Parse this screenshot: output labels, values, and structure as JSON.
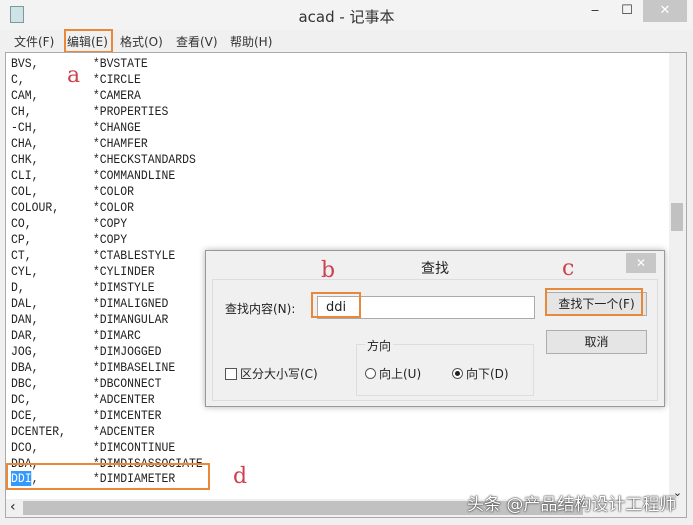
{
  "window": {
    "title": "acad - 记事本",
    "minimize": "‒",
    "maximize": "☐",
    "close": "✕"
  },
  "menu": [
    "文件(F)",
    "编辑(E)",
    "格式(O)",
    "查看(V)",
    "帮助(H)"
  ],
  "lines": [
    [
      "BVS,",
      "*BVSTATE"
    ],
    [
      "C,",
      "*CIRCLE"
    ],
    [
      "CAM,",
      "*CAMERA"
    ],
    [
      "CH,",
      "*PROPERTIES"
    ],
    [
      "-CH,",
      "*CHANGE"
    ],
    [
      "CHA,",
      "*CHAMFER"
    ],
    [
      "CHK,",
      "*CHECKSTANDARDS"
    ],
    [
      "CLI,",
      "*COMMANDLINE"
    ],
    [
      "COL,",
      "*COLOR"
    ],
    [
      "COLOUR,",
      "*COLOR"
    ],
    [
      "CO,",
      "*COPY"
    ],
    [
      "CP,",
      "*COPY"
    ],
    [
      "CT,",
      "*CTABLESTYLE"
    ],
    [
      "CYL,",
      "*CYLINDER"
    ],
    [
      "D,",
      "*DIMSTYLE"
    ],
    [
      "DAL,",
      "*DIMALIGNED"
    ],
    [
      "DAN,",
      "*DIMANGULAR"
    ],
    [
      "DAR,",
      "*DIMARC"
    ],
    [
      "JOG,",
      "*DIMJOGGED"
    ],
    [
      "DBA,",
      "*DIMBASELINE"
    ],
    [
      "DBC,",
      "*DBCONNECT"
    ],
    [
      "DC,",
      "*ADCENTER"
    ],
    [
      "DCE,",
      "*DIMCENTER"
    ],
    [
      "DCENTER,",
      "*ADCENTER"
    ],
    [
      "DCO,",
      "*DIMCONTINUE"
    ],
    [
      "DDA,",
      "*DIMDISASSOCIATE"
    ]
  ],
  "last_line": {
    "selected": "DDI",
    ",": ",",
    "rest": ",",
    "cmd": "*DIMDIAMETER"
  },
  "dialog": {
    "title": "查找",
    "close": "✕",
    "find_label": "查找内容(N):",
    "find_value": "ddi",
    "find_next": "查找下一个(F)",
    "cancel": "取消",
    "direction": "方向",
    "up": "向上(U)",
    "down": "向下(D)",
    "match_case": "区分大小写(C)"
  },
  "annotations": {
    "a": "a",
    "b": "b",
    "c": "c",
    "d": "d"
  },
  "scroll": {
    "left": "‹",
    "down": "⌄"
  },
  "watermark": "头条 @产品结构设计工程师"
}
